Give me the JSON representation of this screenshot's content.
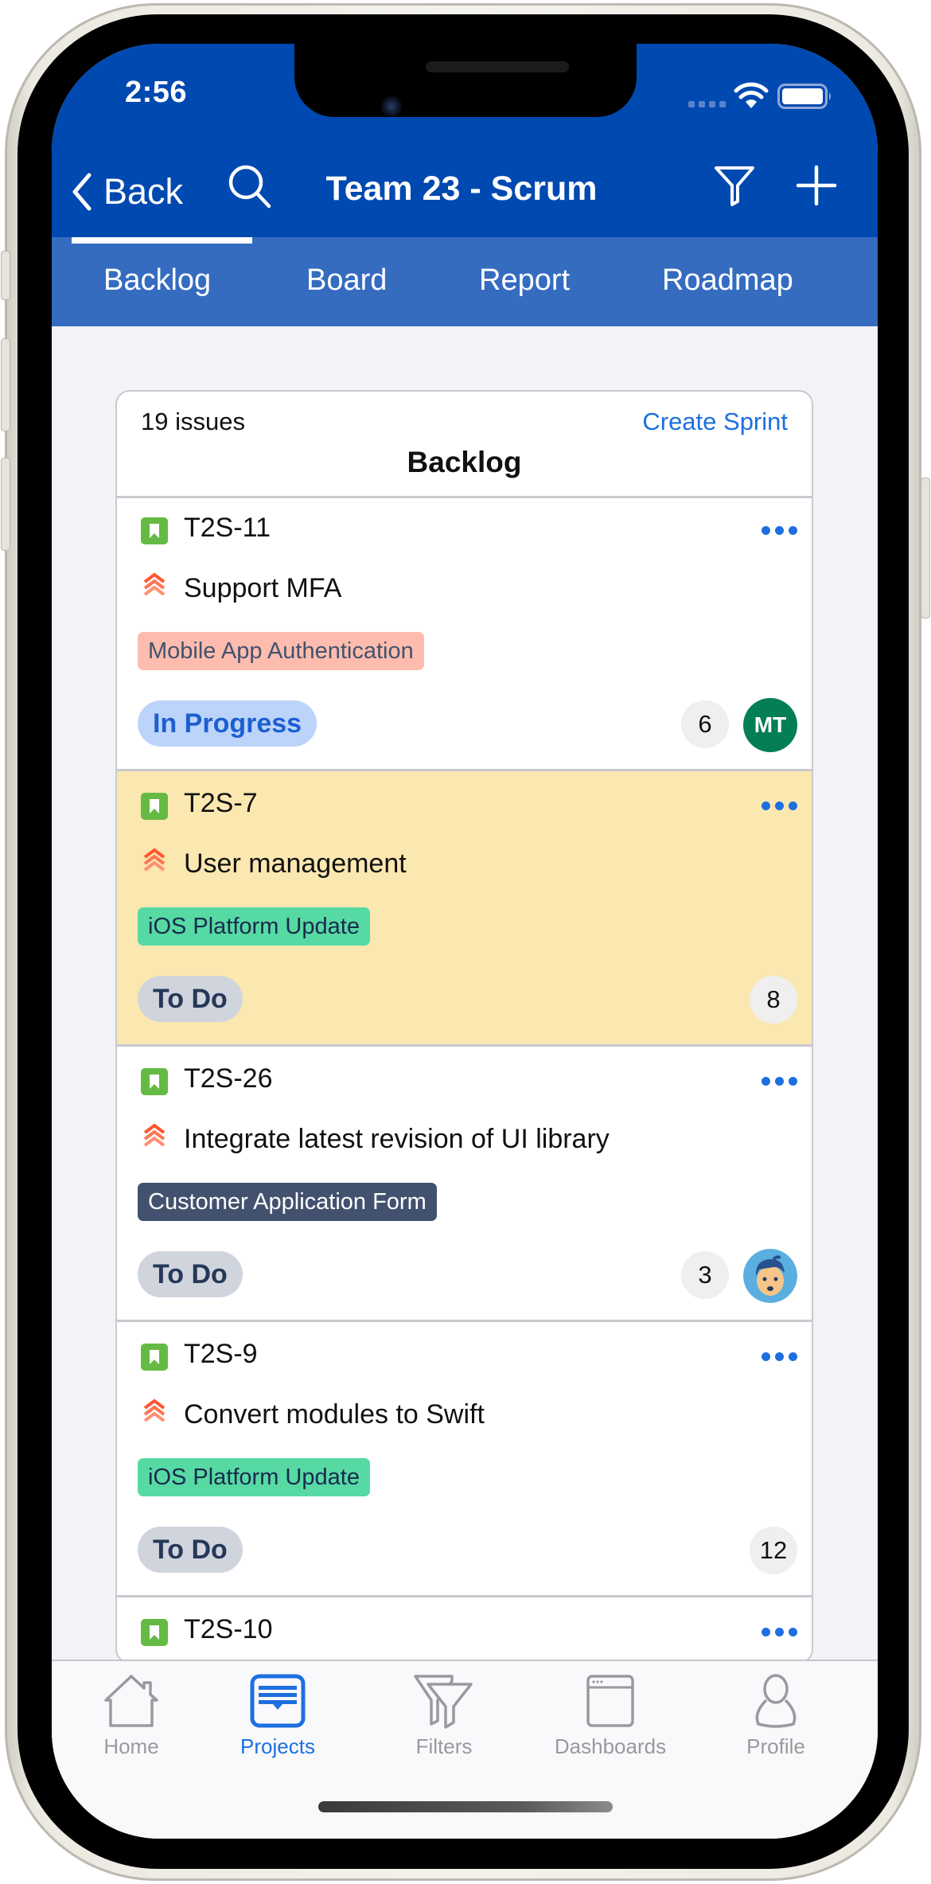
{
  "status_bar": {
    "time": "2:56",
    "icons": [
      "cellular-signal-icon",
      "wifi-icon",
      "battery-icon"
    ]
  },
  "nav": {
    "back_label": "Back",
    "title": "Team 23 - Scrum",
    "icons": [
      "chevron-left-icon",
      "search-icon",
      "filter-icon",
      "plus-icon"
    ]
  },
  "tabs": [
    {
      "label": "Backlog",
      "active": true
    },
    {
      "label": "Board",
      "active": false
    },
    {
      "label": "Report",
      "active": false
    },
    {
      "label": "Roadmap",
      "active": false
    }
  ],
  "backlog": {
    "issue_count": "19 issues",
    "create_sprint_label": "Create Sprint",
    "title": "Backlog",
    "issues": [
      {
        "key": "T2S-11",
        "type": "story",
        "priority": "highest",
        "summary": "Support MFA",
        "epic": "Mobile App Authentication",
        "epic_bg": "#fdbcad",
        "epic_fg": "#42526e",
        "status": "In Progress",
        "status_bg": "#bcd4fa",
        "status_fg": "#1d5fd0",
        "points": "6",
        "assignee": {
          "initials": "MT",
          "color": "#037e55"
        },
        "highlighted": false
      },
      {
        "key": "T2S-7",
        "type": "story",
        "priority": "highest",
        "summary": "User management",
        "epic": "iOS Platform Update",
        "epic_bg": "#57d9a3",
        "epic_fg": "#172b4d",
        "status": "To Do",
        "status_bg": "#d0d4dd",
        "status_fg": "#253858",
        "points": "8",
        "assignee": null,
        "highlighted": true
      },
      {
        "key": "T2S-26",
        "type": "story",
        "priority": "highest",
        "summary": "Integrate latest revision of UI library",
        "epic": "Customer Application Form",
        "epic_bg": "#42526e",
        "epic_fg": "#ffffff",
        "status": "To Do",
        "status_bg": "#d0d4dd",
        "status_fg": "#253858",
        "points": "3",
        "assignee": {
          "avatar": "cartoon-avatar"
        },
        "highlighted": false
      },
      {
        "key": "T2S-9",
        "type": "story",
        "priority": "highest",
        "summary": "Convert modules to Swift",
        "epic": "iOS Platform Update",
        "epic_bg": "#57d9a3",
        "epic_fg": "#172b4d",
        "status": "To Do",
        "status_bg": "#d0d4dd",
        "status_fg": "#253858",
        "points": "12",
        "assignee": null,
        "highlighted": false
      },
      {
        "key": "T2S-10",
        "type": "story",
        "highlighted": false
      }
    ]
  },
  "bottom_tabs": [
    {
      "label": "Home",
      "icon": "home-icon",
      "active": false
    },
    {
      "label": "Projects",
      "icon": "projects-icon",
      "active": true
    },
    {
      "label": "Filters",
      "icon": "filters-icon",
      "active": false
    },
    {
      "label": "Dashboards",
      "icon": "dashboards-icon",
      "active": false
    },
    {
      "label": "Profile",
      "icon": "profile-icon",
      "active": false
    }
  ],
  "colors": {
    "nav_bg": "#0049b0",
    "tab_bg": "#356cc0",
    "accent": "#1d6fe0",
    "highlight_row": "#fbe7b0",
    "story_icon": "#65ba43",
    "priority_icon": "#ff5630"
  }
}
